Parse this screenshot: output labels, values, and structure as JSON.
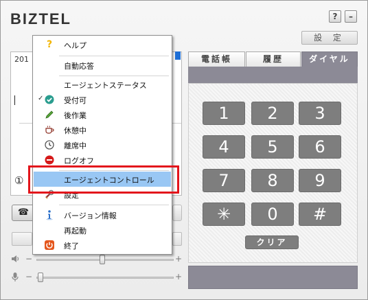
{
  "app": {
    "logo": "BIZTEL",
    "help_button": "?",
    "minimize_button": "–",
    "settings_button": "設 定"
  },
  "left_panel": {
    "text_fragment": "201",
    "circled_marker": "①",
    "phone_symbol": "☎",
    "speaker_minus": "−",
    "speaker_plus": "+",
    "mic_minus": "−",
    "mic_plus": "+",
    "speaker_icon": "speaker-icon",
    "mic_icon": "microphone-icon",
    "speaker_volume": 0.5,
    "mic_volume": 0.0
  },
  "tabs": {
    "phonebook": "電話帳",
    "history": "履歴",
    "dial": "ダイヤル",
    "active": "dial"
  },
  "dialpad": {
    "keys": [
      "1",
      "2",
      "3",
      "4",
      "5",
      "6",
      "7",
      "8",
      "9",
      "✳",
      "0",
      "#"
    ],
    "clear": "クリア"
  },
  "menu": {
    "items": [
      {
        "label": "ヘルプ",
        "icon": "question-icon",
        "checked": false
      },
      {
        "label": "自動応答",
        "icon": "",
        "checked": false
      },
      {
        "label": "エージェントステータス",
        "icon": "",
        "checked": false
      },
      {
        "label": "受付可",
        "icon": "available-check-icon",
        "checked": true
      },
      {
        "label": "後作業",
        "icon": "pencil-icon",
        "checked": false
      },
      {
        "label": "休憩中",
        "icon": "coffee-cup-icon",
        "checked": false
      },
      {
        "label": "離席中",
        "icon": "clock-icon",
        "checked": false
      },
      {
        "label": "ログオフ",
        "icon": "logoff-icon",
        "checked": false
      },
      {
        "label": "エージェントコントロール",
        "icon": "",
        "checked": false
      },
      {
        "label": "設定",
        "icon": "wrench-icon",
        "checked": false
      },
      {
        "label": "バージョン情報",
        "icon": "info-icon",
        "checked": false
      },
      {
        "label": "再起動",
        "icon": "",
        "checked": false
      },
      {
        "label": "終了",
        "icon": "power-icon",
        "checked": false
      }
    ],
    "check_mark": "✓",
    "highlighted_index": 8
  },
  "colors": {
    "tab_active": "#8c8a96",
    "key_bg": "#7e7e7e",
    "highlight": "#99c7f4",
    "annotation_border": "#e3141b",
    "accent_blue": "#1e6fd6"
  }
}
